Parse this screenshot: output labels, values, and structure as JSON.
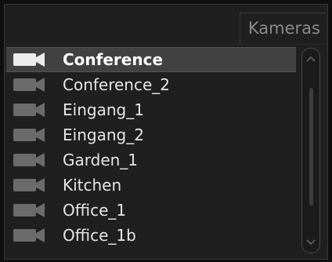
{
  "panel": {
    "title": "Kameras"
  },
  "cameras": [
    {
      "label": "Conference",
      "selected": true
    },
    {
      "label": "Conference_2",
      "selected": false
    },
    {
      "label": "Eingang_1",
      "selected": false
    },
    {
      "label": "Eingang_2",
      "selected": false
    },
    {
      "label": "Garden_1",
      "selected": false
    },
    {
      "label": "Kitchen",
      "selected": false
    },
    {
      "label": "Office_1",
      "selected": false
    },
    {
      "label": "Office_1b",
      "selected": false
    }
  ],
  "icons": {
    "camera": "video-camera-icon",
    "scroll_up": "chevron-up-icon",
    "scroll_down": "chevron-down-icon"
  },
  "colors": {
    "selected_icon": "#ececec",
    "icon": "#6b6b6b",
    "selected_row": "#414141"
  }
}
